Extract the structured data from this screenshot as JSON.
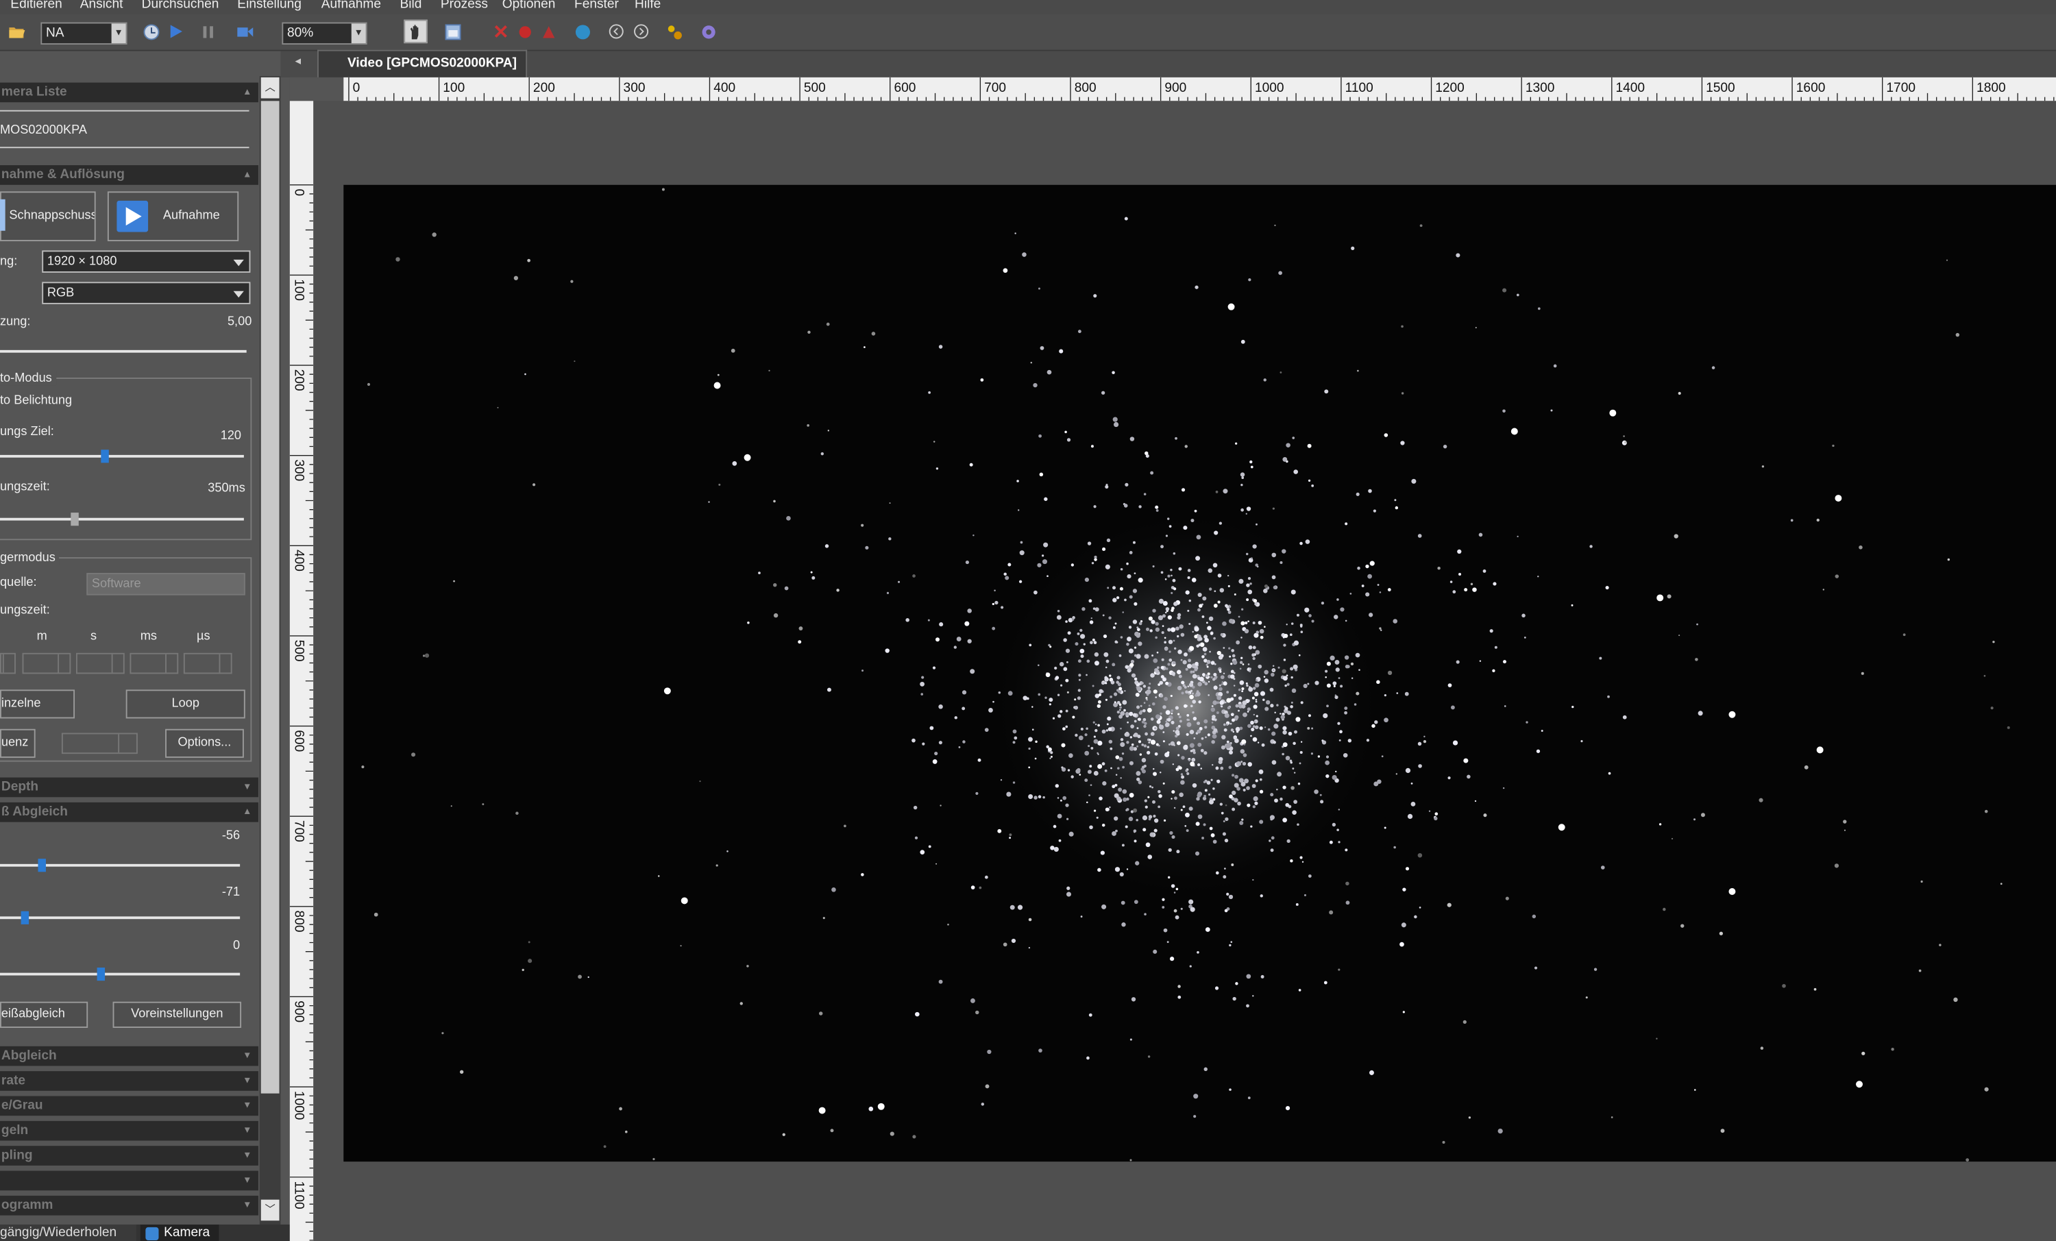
{
  "menu": [
    "Editieren",
    "Ansicht",
    "Durchsuchen",
    "Einstellung",
    "Aufnahme",
    "Bild",
    "Prozess",
    "Optionen",
    "Fenster",
    "Hilfe"
  ],
  "toolbar": {
    "camera_combo": "NA",
    "zoom_combo": "80%"
  },
  "panel": {
    "camera_list_title": "mera Liste",
    "camera_name": "MOS02000KPA",
    "capture_title": "nahme & Auflösung",
    "snap_label": "Schnappschuss",
    "record_label": "Aufnahme",
    "resolution_label": "ng:",
    "resolution_value": "1920 × 1080",
    "format_value": "RGB",
    "exposure_label": "zung:",
    "exposure_value": "5,00",
    "auto_mode_title": "to-Modus",
    "auto_exposure_label": "to Belichtung",
    "target_label": "ungs Ziel:",
    "target_value": "120",
    "time_label": "ungszeit:",
    "time_value": "350ms",
    "trigger_title": "germodus",
    "source_label": "quelle:",
    "source_value": "Software",
    "trigger_time_label": "ungszeit:",
    "units": [
      "m",
      "s",
      "ms",
      "µs"
    ],
    "single_label": "inzelne",
    "loop_label": "Loop",
    "seq_label": "uenz",
    "options_label": "Options...",
    "depth_title": "Depth",
    "wb_title": "ß Abgleich",
    "wb_values": [
      "-56",
      "-71",
      "0"
    ],
    "wb_button": "eißabgleich",
    "preset_button": "Voreinstellungen",
    "collapsed_sections": [
      "Abgleich",
      "rate",
      "e/Grau",
      "geln",
      "pling",
      "",
      "ogramm"
    ]
  },
  "bottom_tabs": [
    "gängig/Wiederholen",
    "Kamera"
  ],
  "doc": {
    "tab_title": "Video [GPCMOS02000KPA]",
    "h_ticks": [
      "0",
      "100",
      "200",
      "300",
      "400",
      "500",
      "600",
      "700",
      "800",
      "900",
      "1000",
      "1100",
      "1200",
      "1300",
      "1400",
      "1500",
      "1600",
      "1700",
      "1800"
    ],
    "v_ticks": [
      "0",
      "100",
      "200",
      "300",
      "400",
      "500",
      "600",
      "700",
      "800",
      "900",
      "1000",
      "1100"
    ]
  }
}
